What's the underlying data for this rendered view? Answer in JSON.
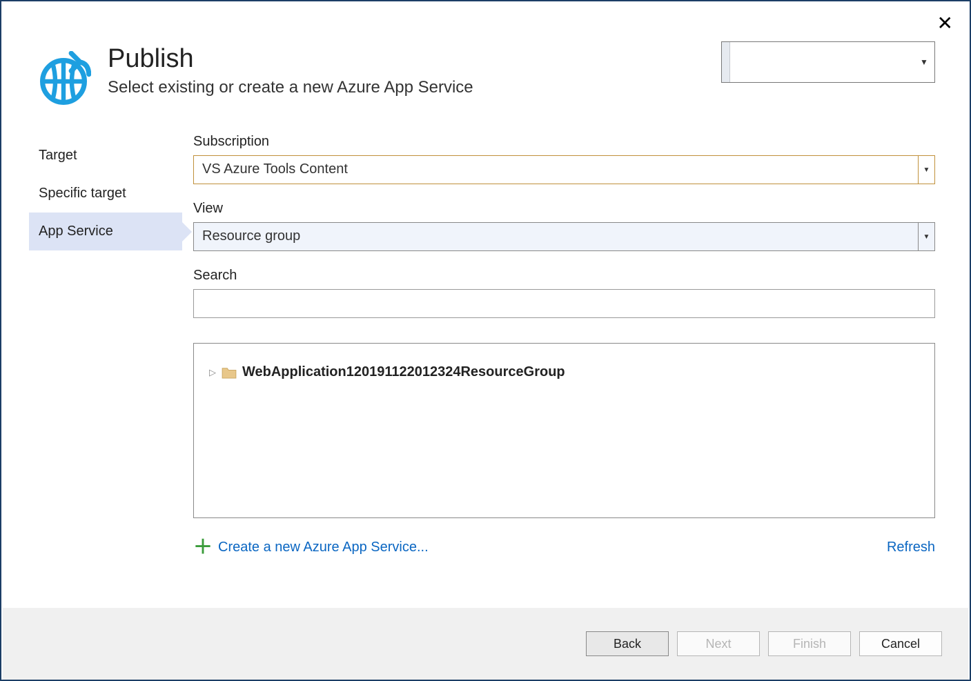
{
  "header": {
    "title": "Publish",
    "subtitle": "Select existing or create a new Azure App Service"
  },
  "sidebar": {
    "items": [
      {
        "label": "Target"
      },
      {
        "label": "Specific target"
      },
      {
        "label": "App Service"
      }
    ]
  },
  "fields": {
    "subscription_label": "Subscription",
    "subscription_value": "VS Azure Tools Content",
    "view_label": "View",
    "view_value": "Resource group",
    "search_label": "Search",
    "search_value": ""
  },
  "tree": {
    "item_label": "WebApplication120191122012324ResourceGroup"
  },
  "links": {
    "create_label": "Create a new Azure App Service...",
    "refresh_label": "Refresh"
  },
  "footer": {
    "back_label": "Back",
    "next_label": "Next",
    "finish_label": "Finish",
    "cancel_label": "Cancel"
  }
}
